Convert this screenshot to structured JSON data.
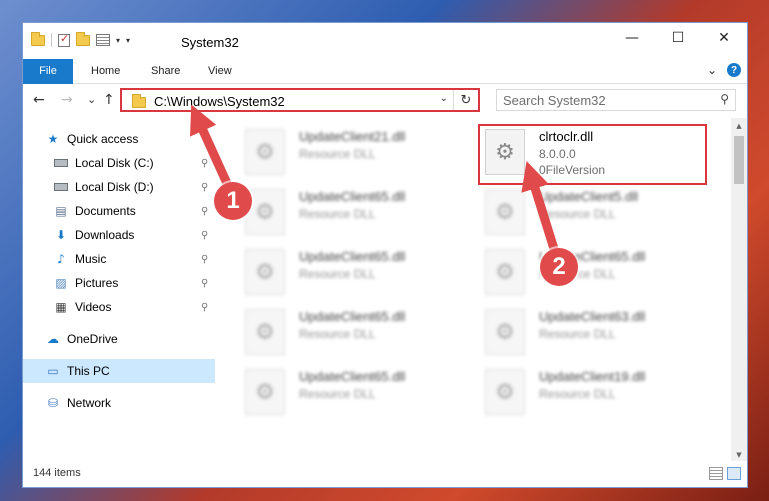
{
  "window": {
    "title": "System32",
    "controls": {
      "minimize": "—",
      "maximize": "☐",
      "close": "✕"
    }
  },
  "ribbon": {
    "tabs": [
      {
        "label": "File"
      },
      {
        "label": "Home"
      },
      {
        "label": "Share"
      },
      {
        "label": "View"
      }
    ],
    "expand_glyph": "⌄",
    "help_glyph": "?"
  },
  "navigation": {
    "back_glyph": "←",
    "forward_glyph": "→",
    "recent_glyph": "⌄",
    "up_glyph": "↑",
    "address": "C:\\Windows\\System32",
    "address_drop_glyph": "⌄",
    "refresh_glyph": "↻",
    "search_placeholder": "Search System32",
    "search_glyph": "⚲"
  },
  "sidebar": {
    "items": [
      {
        "label": "Quick access",
        "icon": "star-icon",
        "glyph": "★",
        "color": "#1979ca",
        "pinned": false
      },
      {
        "label": "Local Disk (C:)",
        "icon": "drive-icon",
        "glyph": "",
        "color": "#6b717a",
        "pinned": true
      },
      {
        "label": "Local Disk (D:)",
        "icon": "drive-icon",
        "glyph": "",
        "color": "#6b717a",
        "pinned": true
      },
      {
        "label": "Documents",
        "icon": "documents-icon",
        "glyph": "▤",
        "color": "#5a6e8c",
        "pinned": true
      },
      {
        "label": "Downloads",
        "icon": "download-icon",
        "glyph": "⬇",
        "color": "#1979ca",
        "pinned": true
      },
      {
        "label": "Music",
        "icon": "music-icon",
        "glyph": "♪",
        "color": "#1979ca",
        "pinned": true
      },
      {
        "label": "Pictures",
        "icon": "pictures-icon",
        "glyph": "▨",
        "color": "#4a7fb5",
        "pinned": true
      },
      {
        "label": "Videos",
        "icon": "videos-icon",
        "glyph": "▦",
        "color": "#444444",
        "pinned": true
      },
      {
        "label": "OneDrive",
        "icon": "cloud-icon",
        "glyph": "☁",
        "color": "#1979ca",
        "pinned": false
      },
      {
        "label": "This PC",
        "icon": "computer-icon",
        "glyph": "▭",
        "color": "#3a77c0",
        "pinned": false,
        "selected": true
      },
      {
        "label": "Network",
        "icon": "network-icon",
        "glyph": "⛁",
        "color": "#3a77c0",
        "pinned": false
      }
    ],
    "pin_glyph": "📌"
  },
  "files": {
    "left_column": [
      {
        "name": "UpdateClient21.dll",
        "type": "Resource DLL"
      },
      {
        "name": "UpdateClient65.dll",
        "type": "Resource DLL"
      },
      {
        "name": "UpdateClient65.dll",
        "type": "Resource DLL"
      },
      {
        "name": "UpdateClient65.dll",
        "type": "Resource DLL"
      },
      {
        "name": "UpdateClient65.dll",
        "type": "Resource DLL"
      }
    ],
    "right_column": [
      {
        "name": "clrtoclr.dll",
        "type": "8.0.0.0",
        "extra": "0FileVersion",
        "highlighted": true
      },
      {
        "name": "UpdateClient5.dll",
        "type": "Resource DLL"
      },
      {
        "name": "UpdateClient65.dll",
        "type": "Resource DLL"
      },
      {
        "name": "UpdateClient63.dll",
        "type": "Resource DLL"
      },
      {
        "name": "UpdateClient19.dll",
        "type": "Resource DLL"
      }
    ],
    "file_glyph": "⚙"
  },
  "status": {
    "item_count": "144 items"
  },
  "annotations": {
    "badge_1": "1",
    "badge_2": "2",
    "color": "#e04a4a"
  }
}
